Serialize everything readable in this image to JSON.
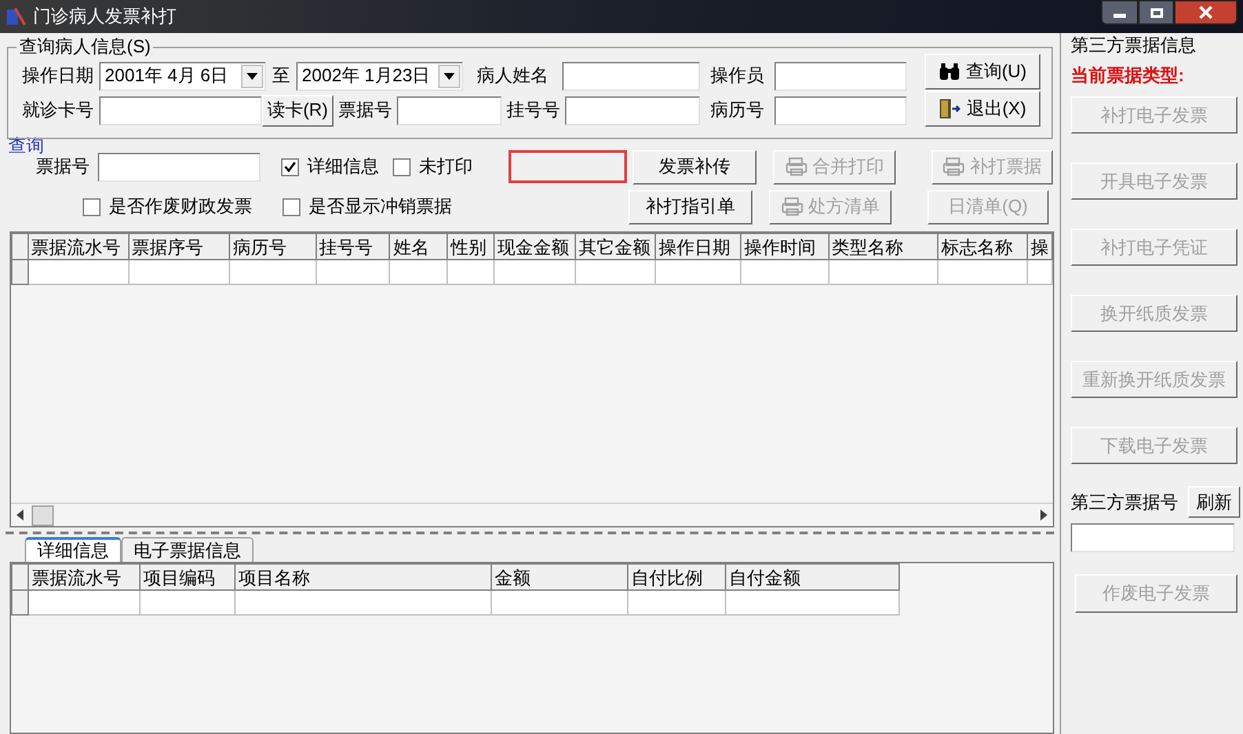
{
  "window": {
    "title": "门诊病人发票补打"
  },
  "query_group": {
    "title": "查询病人信息(S)",
    "row1": [
      {
        "kind": "label",
        "text": "操作日期"
      },
      {
        "kind": "combo",
        "value": "2001年 4月 6日"
      },
      {
        "kind": "label",
        "text": "至"
      },
      {
        "kind": "combo",
        "value": "2002年 1月23日"
      },
      {
        "kind": "label",
        "text": "病人姓名"
      },
      {
        "kind": "field"
      },
      {
        "kind": "label",
        "text": "操作员"
      },
      {
        "kind": "field"
      }
    ],
    "row2": [
      {
        "kind": "label",
        "text": "就诊卡号"
      },
      {
        "kind": "field"
      },
      {
        "kind": "button",
        "text": "读卡(R)",
        "disabled": false
      },
      {
        "kind": "label",
        "text": "票据号"
      },
      {
        "kind": "field"
      },
      {
        "kind": "label",
        "text": "挂号号"
      },
      {
        "kind": "field"
      },
      {
        "kind": "label",
        "text": "病历号"
      },
      {
        "kind": "field"
      }
    ],
    "search_button": {
      "text": "查询(U)",
      "disabled": false
    },
    "exit_button": {
      "text": "退出(X)",
      "disabled": false
    }
  },
  "result_label": "查询",
  "filter_row1": {
    "label": "票据号",
    "checks": [
      {
        "text": "详细信息",
        "checked": true
      },
      {
        "text": "未打印",
        "checked": false
      }
    ]
  },
  "filter_row2": {
    "checks": [
      {
        "text": "是否作废财政发票",
        "checked": false
      },
      {
        "text": "是否显示冲销票据",
        "checked": false
      }
    ]
  },
  "action_buttons": [
    {
      "text": "发票补传",
      "disabled": false,
      "print_icon": false
    },
    {
      "text": "合并打印",
      "disabled": true,
      "print_icon": true
    },
    {
      "text": "补打票据",
      "disabled": true,
      "print_icon": true
    },
    {
      "text": "补打指引单",
      "disabled": false,
      "print_icon": false
    },
    {
      "text": "处方清单",
      "disabled": true,
      "print_icon": true
    },
    {
      "text": "日清单(Q)",
      "disabled": true,
      "print_icon": false
    }
  ],
  "table": {
    "columns": [
      "票据流水号",
      "票据序号",
      "病历号",
      "挂号号",
      "姓名",
      "性别",
      "现金金额",
      "其它金额",
      "操作日期",
      "操作时间",
      "类型名称",
      "标志名称",
      "操"
    ]
  },
  "tabs": [
    {
      "label": "详细信息",
      "selected": true
    },
    {
      "label": "电子票据信息",
      "selected": false
    }
  ],
  "detail_table": {
    "columns": [
      "票据流水号",
      "项目编码",
      "项目名称",
      "金额",
      "自付比例",
      "自付金额"
    ]
  },
  "side_panel": {
    "title": "第三方票据信息",
    "type_label": "当前票据类型:",
    "buttons": [
      {
        "text": "补打电子发票",
        "disabled": true
      },
      {
        "text": "开具电子发票",
        "disabled": true
      },
      {
        "text": "补打电子凭证",
        "disabled": true
      },
      {
        "text": "换开纸质发票",
        "disabled": true
      },
      {
        "text": "重新换开纸质发票",
        "disabled": true
      },
      {
        "text": "下载电子发票",
        "disabled": true
      }
    ],
    "number_label": "第三方票据号",
    "refresh_button": {
      "text": "刷新",
      "disabled": false
    },
    "void_button": {
      "text": "作废电子发票",
      "disabled": true
    }
  }
}
